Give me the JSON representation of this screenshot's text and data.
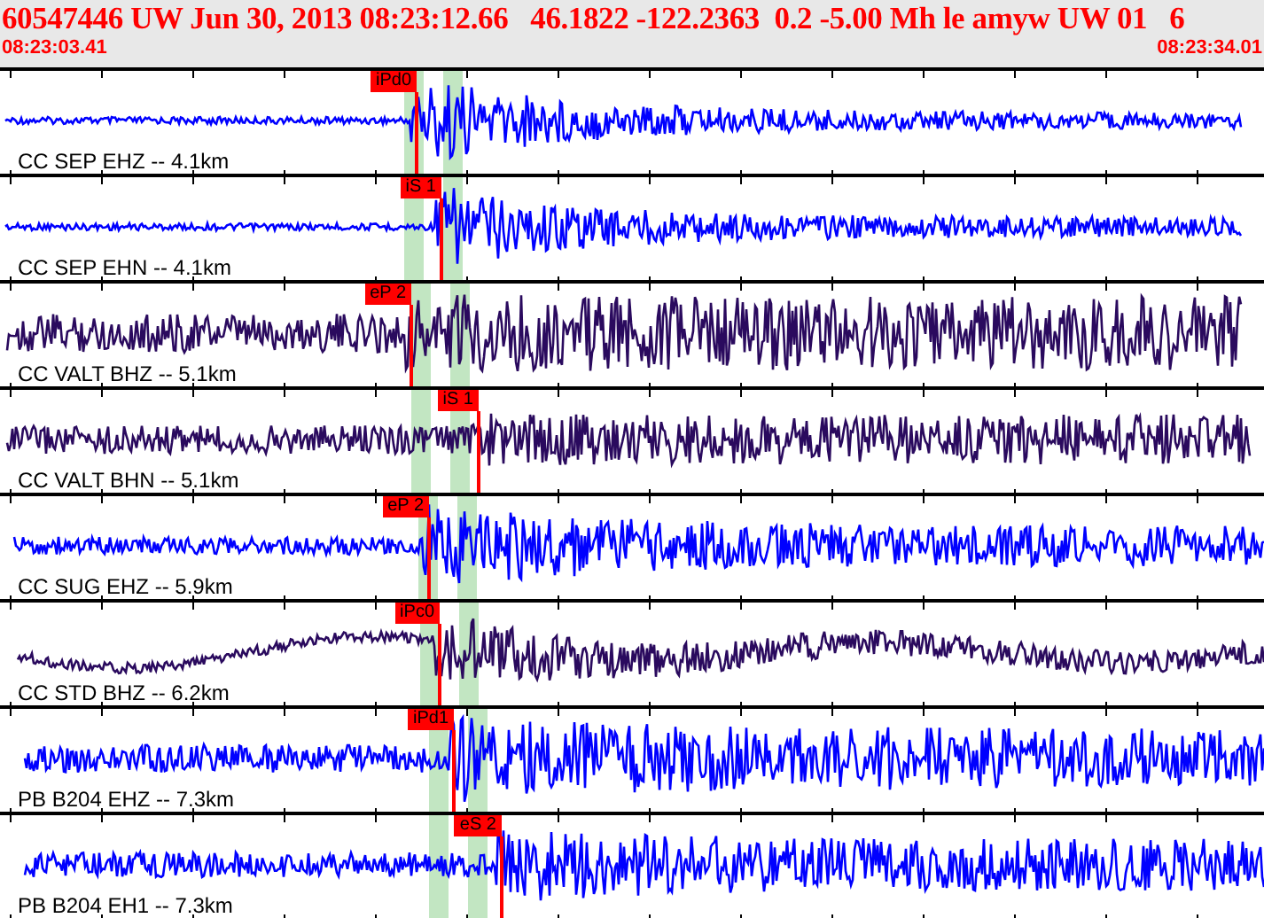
{
  "header": {
    "title": "60547446 UW Jun 30, 2013 08:23:12.66   46.1822 -122.2363  0.2 -5.00 Mh le amyw UW 01   6",
    "start_time": "08:23:03.41",
    "end_time": "08:23:34.01"
  },
  "traces": [
    {
      "label": "CC SEP EHZ -- 4.1km",
      "pick": "iPd0",
      "color": "#0000ff"
    },
    {
      "label": "CC SEP EHN -- 4.1km",
      "pick": "iS 1",
      "color": "#0000ff"
    },
    {
      "label": "CC VALT BHZ -- 5.1km",
      "pick": "eP 2",
      "color": "#2a0a5e"
    },
    {
      "label": "CC VALT BHN -- 5.1km",
      "pick": "iS 1",
      "color": "#2a0a5e"
    },
    {
      "label": "CC SUG EHZ -- 5.9km",
      "pick": "eP 2",
      "color": "#0000ff"
    },
    {
      "label": "CC STD BHZ -- 6.2km",
      "pick": "iPc0",
      "color": "#2a0a5e"
    },
    {
      "label": "PB B204 EHZ -- 7.3km",
      "pick": "iPd1",
      "color": "#0000ff"
    },
    {
      "label": "PB B204 EH1 -- 7.3km",
      "pick": "eS 2",
      "color": "#0000ff"
    }
  ]
}
